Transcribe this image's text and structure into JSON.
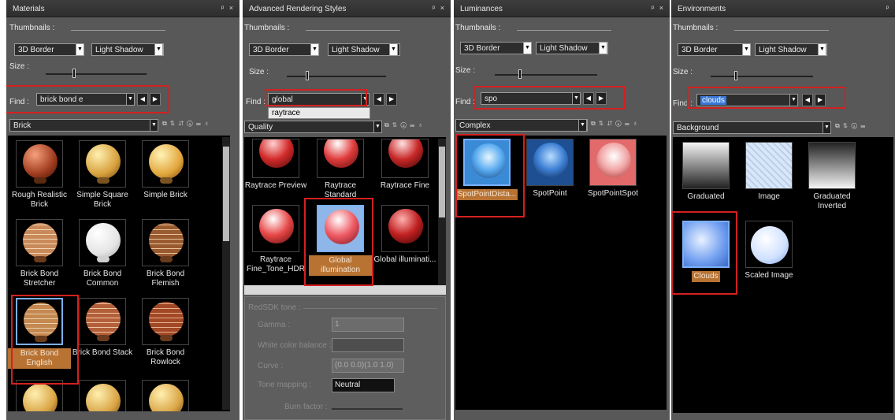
{
  "panels": {
    "materials": {
      "title": "Materials",
      "thumbnails_label": "Thumbnails :",
      "border_value": "3D Border",
      "shadow_value": "Light Shadow",
      "size_label": "Size :",
      "find_label": "Find :",
      "find_value": "brick bond e",
      "category": "Brick",
      "items": [
        "Rough Realistic Brick",
        "Simple Square Brick",
        "Simple Brick",
        "Brick Bond Stretcher",
        "Brick Bond Common",
        "Brick Bond Flemish",
        "Brick Bond English",
        "Brick Bond Stack",
        "Brick Bond Rowlock"
      ]
    },
    "rendering": {
      "title": "Advanced Rendering Styles",
      "thumbnails_label": "Thumbnails :",
      "border_value": "3D Border",
      "shadow_value": "Light Shadow",
      "size_label": "Size :",
      "find_label": "Find :",
      "find_value": "global",
      "dropdown_suggestion": "raytrace",
      "category": "Quality",
      "items": [
        "Raytrace Preview",
        "Raytrace Standard",
        "Raytrace Fine",
        "Raytrace Fine_Tone_HDR",
        "Global illumination",
        "Global illuminati..."
      ],
      "tone_section": "RedSDK tone :",
      "gamma_label": "Gamma :",
      "gamma_value": "1",
      "white_balance_label": "White color balance :",
      "curve_label": "Curve :",
      "curve_value": "(0.0 0.0)(1.0 1.0)",
      "tone_mapping_label": "Tone mapping :",
      "tone_mapping_value": "Neutral",
      "burn_label": "Burn factor :"
    },
    "luminances": {
      "title": "Luminances",
      "thumbnails_label": "Thumbnails :",
      "border_value": "3D Border",
      "shadow_value": "Light Shadow",
      "size_label": "Size :",
      "find_label": "Find :",
      "find_value": "spo",
      "category": "Complex",
      "items": [
        "SpotPointDista...",
        "SpotPoint",
        "SpotPointSpot"
      ]
    },
    "environments": {
      "title": "Environments",
      "thumbnails_label": "Thumbnails :",
      "border_value": "3D Border",
      "shadow_value": "Light Shadow",
      "size_label": "Size :",
      "find_label": "Find :",
      "find_value": "clouds",
      "category": "Background",
      "items": [
        "Graduated",
        "Image",
        "Graduated Inverted",
        "Clouds",
        "Scaled Image"
      ]
    }
  },
  "title_buttons": "ᵖ ×",
  "icons": [
    "pin-icon",
    "close-icon",
    "dropdown-arrow-icon",
    "prev-arrow-icon",
    "next-arrow-icon",
    "sort-icon",
    "filter-icon",
    "properties-icon"
  ]
}
